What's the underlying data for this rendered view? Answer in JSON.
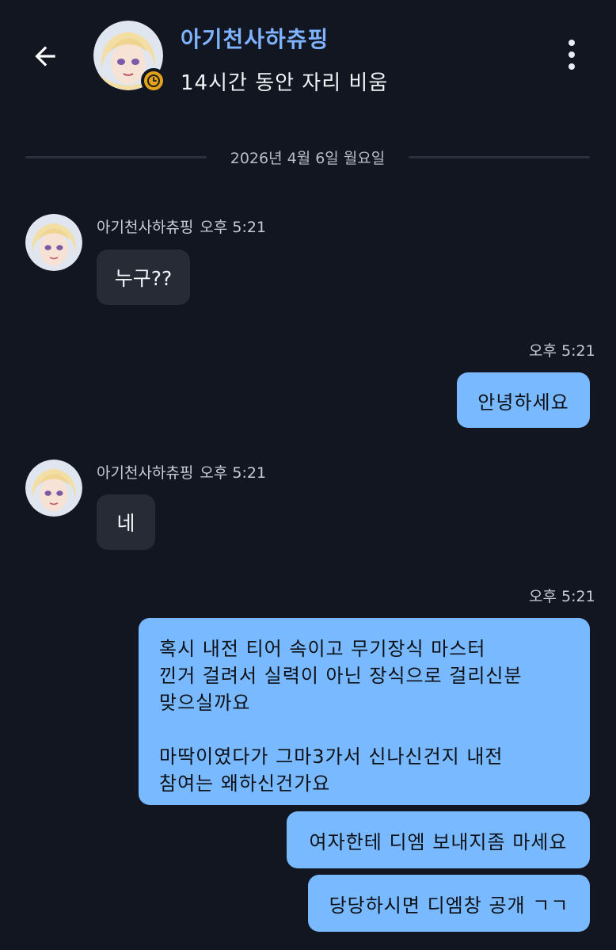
{
  "header": {
    "name": "아기천사하츄핑",
    "status": "14시간 동안 자리 비움"
  },
  "date_divider": "2026년 4월 6일 월요일",
  "messages": [
    {
      "direction": "in",
      "sender": "아기천사하츄핑",
      "time": "오후 5:21",
      "text": "누구??"
    },
    {
      "direction": "out",
      "time": "오후 5:21",
      "text": "안녕하세요"
    },
    {
      "direction": "in",
      "sender": "아기천사하츄핑",
      "time": "오후 5:21",
      "text": "네"
    },
    {
      "direction": "out",
      "time": "오후 5:21",
      "lines": [
        "혹시 내전 티어 속이고 무기장식 마스터",
        "낀거 걸려서 실력이 아닌 장식으로 걸리신분",
        "맞으실까요",
        "",
        "마딱이였다가 그마3가서 신나신건지 내전",
        "참여는 왜하신건가요"
      ]
    },
    {
      "direction": "out",
      "text": "여자한테 디엠 보내지좀 마세요"
    },
    {
      "direction": "out",
      "text": "당당하시면 디엠창 공개 ㄱㄱ"
    }
  ],
  "colors": {
    "background": "#121620",
    "incoming_bubble": "#262b36",
    "outgoing_bubble": "#79b9ff",
    "name_accent": "#7fb3ff",
    "away_status": "#e4a21c"
  },
  "icons": {
    "back": "arrow-left-icon",
    "more": "more-vertical-icon",
    "status": "clock-icon"
  }
}
